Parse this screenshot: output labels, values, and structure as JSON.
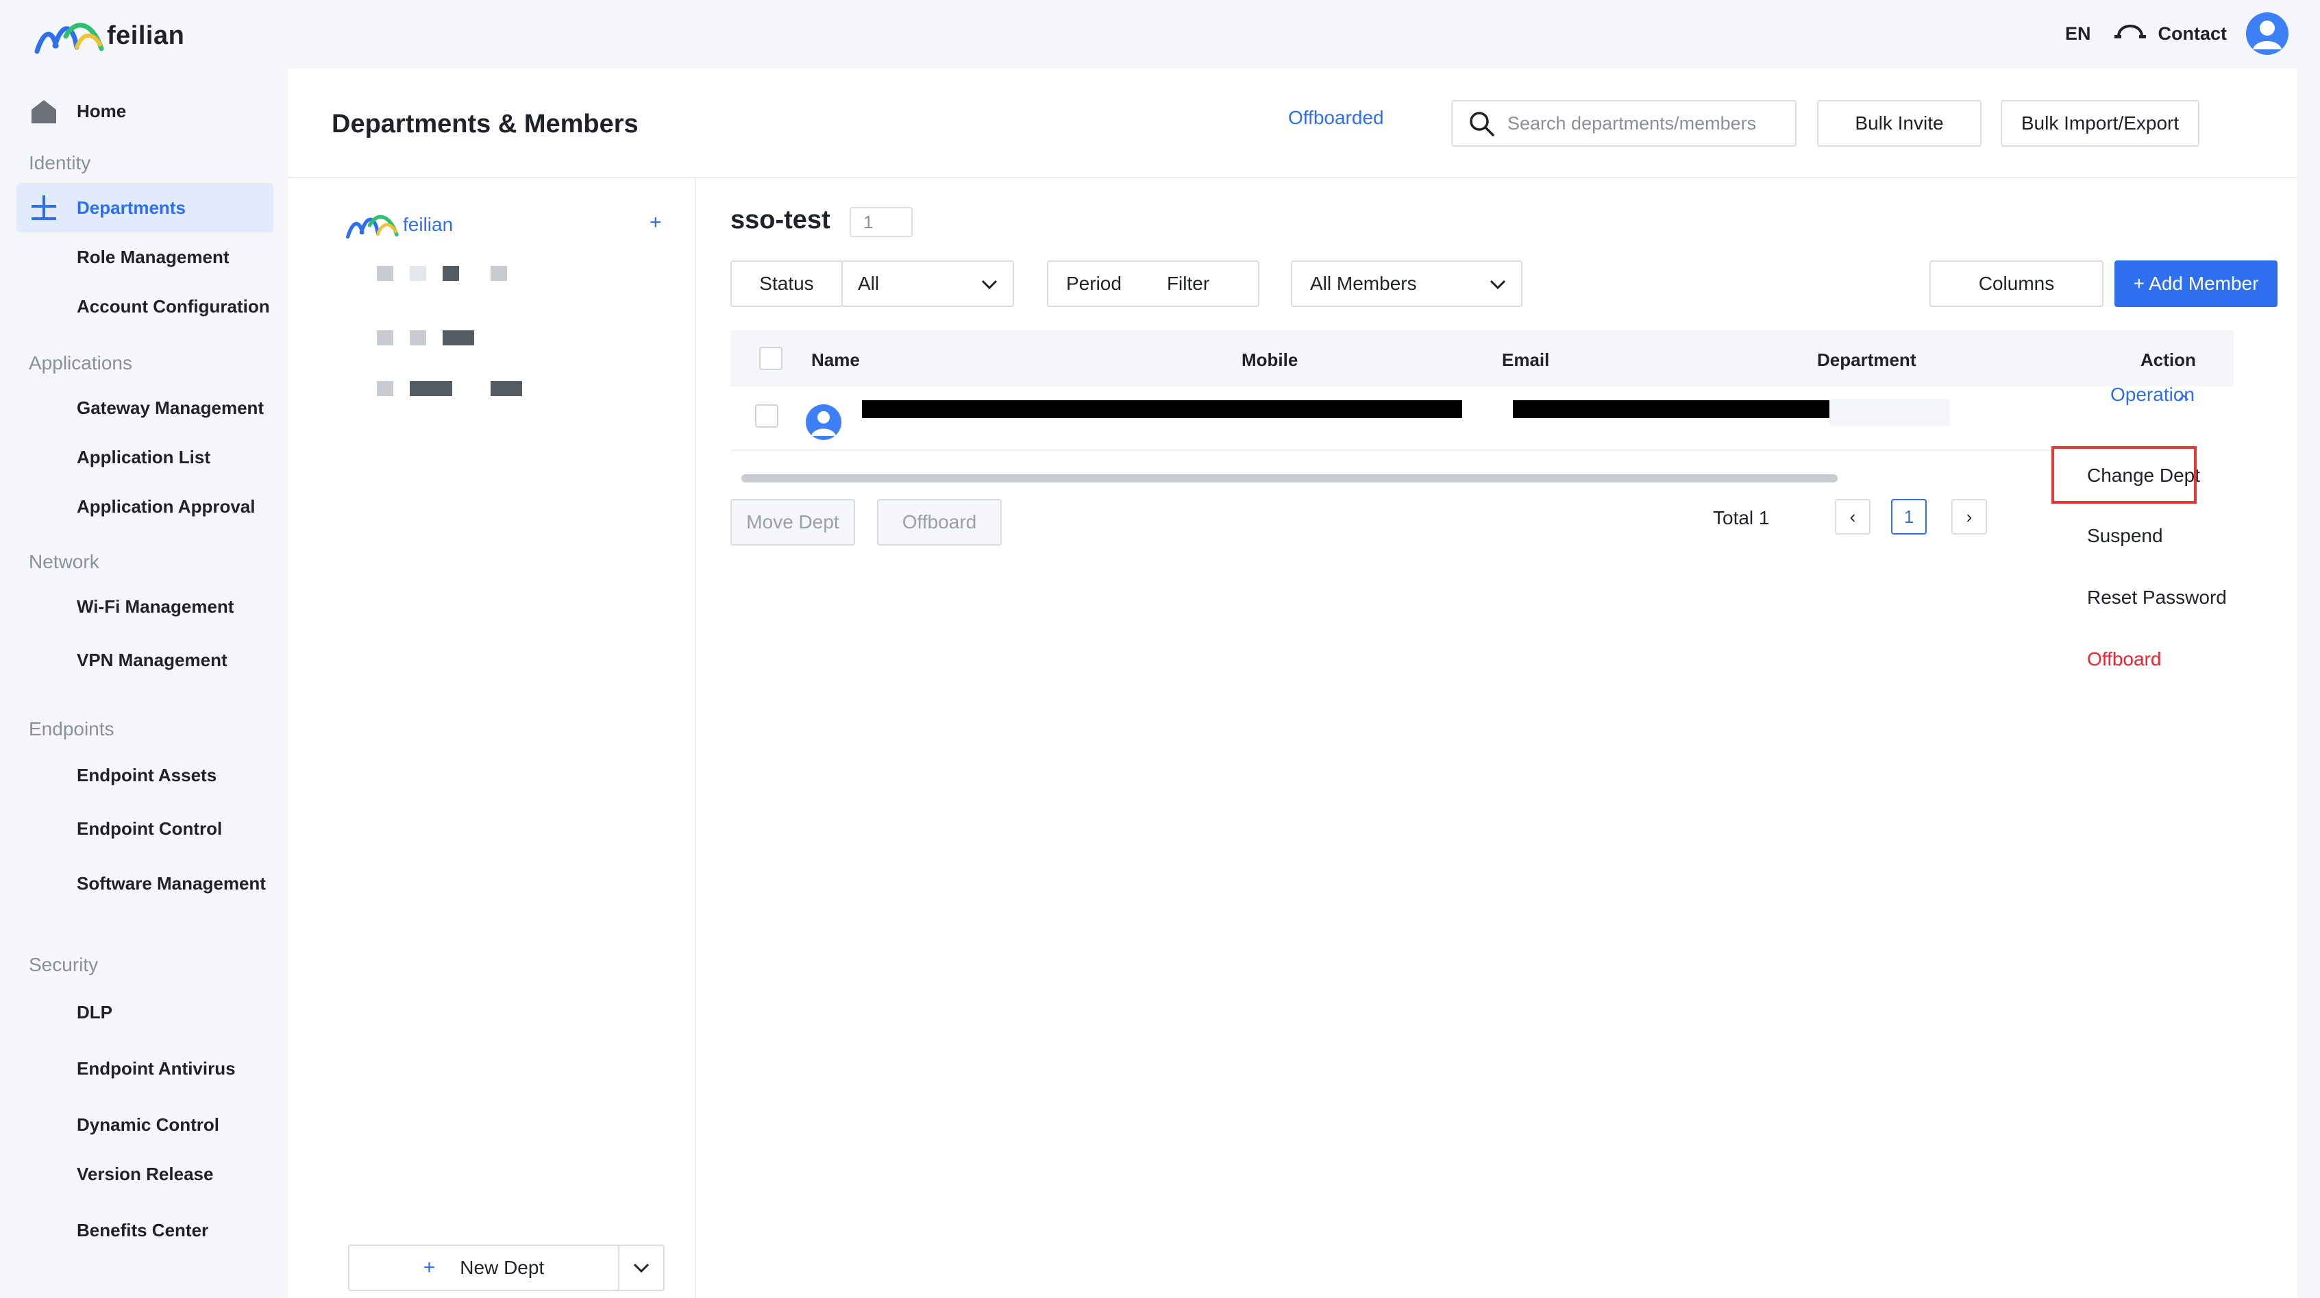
{
  "brand": {
    "name": "feilian"
  },
  "topbar": {
    "language": "EN",
    "contact": "Contact"
  },
  "sidebar": {
    "home": "Home",
    "groups": {
      "identity": "Identity",
      "applications": "Applications",
      "network": "Network",
      "endpoints": "Endpoints",
      "security": "Security"
    },
    "items": {
      "departments": "Departments",
      "role_management": "Role Management",
      "account_configuration": "Account Configuration",
      "gateway_management": "Gateway Management",
      "application_list": "Application List",
      "application_approval": "Application Approval",
      "wifi_management": "Wi-Fi Management",
      "vpn_management": "VPN Management",
      "endpoint_assets": "Endpoint Assets",
      "endpoint_control": "Endpoint Control",
      "software_management": "Software Management",
      "dlp": "DLP",
      "endpoint_antivirus": "Endpoint Antivirus",
      "dynamic_control": "Dynamic Control",
      "version_release": "Version Release",
      "benefits_center": "Benefits Center"
    },
    "active_color": "#2e6ff0"
  },
  "header": {
    "title": "Departments & Members",
    "offboarded_link": "Offboarded",
    "search_placeholder": "Search departments/members",
    "bulk_invite": "Bulk Invite",
    "bulk_import_export": "Bulk Import/Export"
  },
  "tree": {
    "root_label": "feilian",
    "add_symbol": "+",
    "new_dept_symbol": "+",
    "new_dept_label": "New Dept"
  },
  "content": {
    "dept_name": "sso-test",
    "member_count": "1",
    "filters": {
      "status_label": "Status",
      "status_value": "All",
      "period_label": "Period",
      "period_filter": "Filter",
      "members_value": "All Members"
    },
    "columns_button": "Columns",
    "add_member_button": "+ Add Member",
    "table": {
      "headers": {
        "name": "Name",
        "mobile": "Mobile",
        "email": "Email",
        "department": "Department",
        "action": "Action"
      },
      "row_action": "Operation"
    },
    "footer": {
      "move_dept": "Move Dept",
      "offboard": "Offboard",
      "total": "Total 1",
      "prev": "‹",
      "page": "1",
      "next": "›"
    }
  },
  "operation_menu": {
    "items": [
      "Change Dept",
      "Suspend",
      "Reset Password",
      "Offboard"
    ],
    "danger_color": "#f5222d",
    "highlight_color": "#e53935"
  },
  "colors": {
    "primary": "#2e6ff0",
    "background": "#f4f6fa"
  }
}
